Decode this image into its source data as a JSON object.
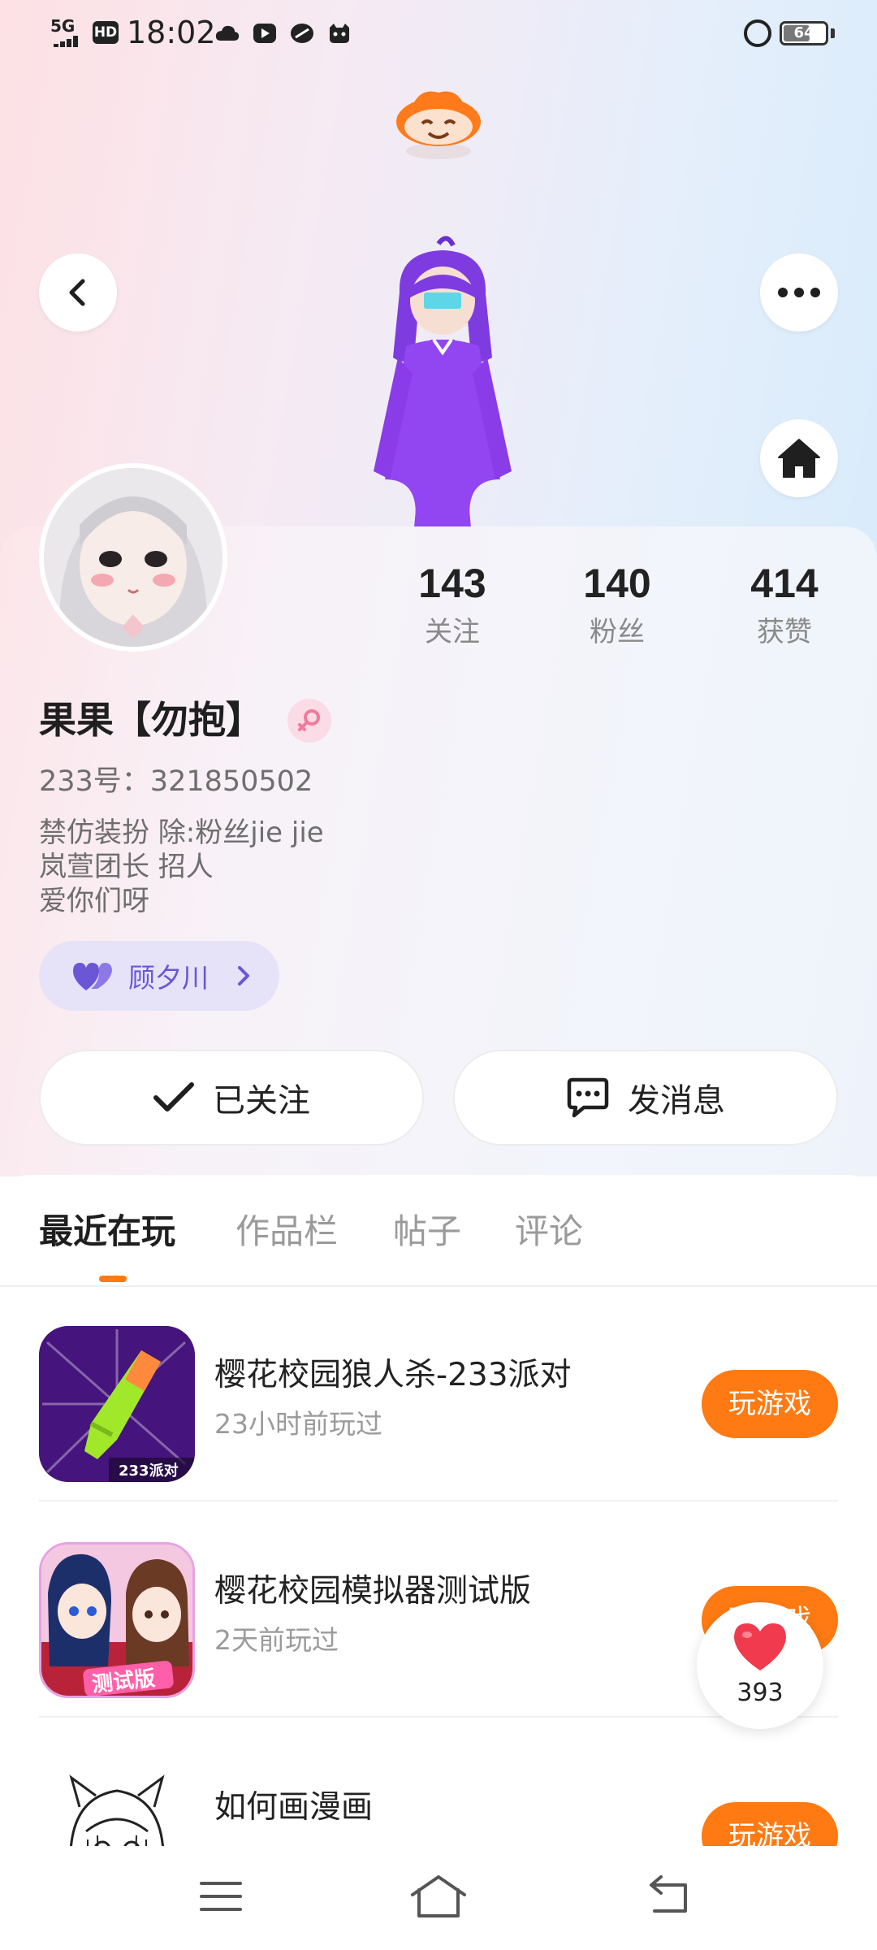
{
  "status_bar": {
    "network": "5G",
    "hd": "HD",
    "time": "18:02",
    "battery": "64",
    "battery_level": 0.64
  },
  "header": {
    "back_icon": "chevron-left-icon",
    "more_icon": "more-dots-icon",
    "home_icon": "home-icon"
  },
  "profile": {
    "stats": [
      {
        "value": "143",
        "label": "关注"
      },
      {
        "value": "140",
        "label": "粉丝"
      },
      {
        "value": "414",
        "label": "获赞"
      }
    ],
    "name": "果果【勿抱】",
    "gender": "female",
    "uid": "233号：321850502",
    "bio": [
      "禁仿装扮 除:粉丝jie jie",
      "岚萱团长 招人",
      "爱你们呀"
    ],
    "friend": {
      "name": "顾夕川",
      "color": "#6b56d6"
    }
  },
  "actions": {
    "follow_label": "已关注",
    "message_label": "发消息"
  },
  "tabs": [
    "最近在玩",
    "作品栏",
    "帖子",
    "评论"
  ],
  "games": [
    {
      "title": "樱花校园狼人杀-233派对",
      "subtitle": "23小时前玩过",
      "button": "玩游戏",
      "badge": "233派对"
    },
    {
      "title": "樱花校园模拟器测试版",
      "subtitle": "2天前玩过",
      "button": "玩游戏",
      "badge": "测试版"
    },
    {
      "title": "如何画漫画",
      "subtitle": "",
      "button": "玩游戏"
    }
  ],
  "like_fab": {
    "count": "393"
  },
  "colors": {
    "accent": "#ff7a12",
    "friend_pill": "#e6e2f8",
    "heart": "#f23a4e"
  }
}
